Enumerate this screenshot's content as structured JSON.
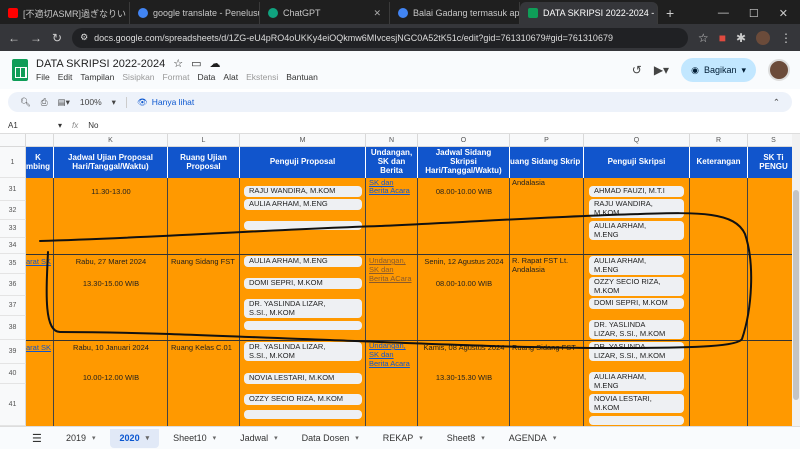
{
  "browser": {
    "tabs": [
      {
        "label": "[不適切ASMR]過ぎなりい",
        "color": "#ff0000"
      },
      {
        "label": "google translate - Penelusuran",
        "color": "#4285f4"
      },
      {
        "label": "ChatGPT",
        "color": "#10a37f"
      },
      {
        "label": "Balai Gadang termasuk apa",
        "color": "#4285f4"
      },
      {
        "label": "DATA SKRIPSI 2022-2024 - G",
        "color": "#0f9d58"
      }
    ],
    "url": "docs.google.com/spreadsheets/d/1ZG-eU4pRO4oUKKy4eiOQkmw6MIvcesjNGC0A52tK51c/edit?gid=761310679#gid=761310679"
  },
  "app": {
    "title": "DATA SKRIPSI 2022-2024",
    "menus": [
      "File",
      "Edit",
      "Tampilan",
      "Sisipkan",
      "Format",
      "Data",
      "Alat",
      "Ekstensi",
      "Bantuan"
    ],
    "menus_dim": [
      false,
      false,
      false,
      true,
      true,
      false,
      false,
      true,
      false
    ],
    "share_label": "Bagikan",
    "zoom": "100%",
    "view_mode": "Hanya lihat",
    "cell_ref": "A1",
    "formula": "No"
  },
  "columns": [
    "K",
    "L",
    "M",
    "N",
    "O",
    "P",
    "Q",
    "R",
    "S"
  ],
  "headers": {
    "j": "K\nmbing",
    "k": "Jadwal Ujian Proposal\nHari/Tanggal/Waktu)",
    "l": "Ruang Ujian\nProposal",
    "m": "Penguji Proposal",
    "n": "Undangan,\nSK dan\nBerita",
    "o": "Jadwal Sidang\nSkripsi\nHari/Tanggal/Waktu)",
    "p": "uang Sidang Skrip",
    "q": "Penguji Skripsi",
    "r": "Keterangan",
    "s": "SK Ti\nPENGU"
  },
  "rows": [
    "1",
    "31",
    "32",
    "33",
    "34",
    "35",
    "36",
    "37",
    "38",
    "39",
    "40",
    "41"
  ],
  "block1": {
    "time": "11.30-13.00",
    "examiners": [
      "RAJU WANDIRA, M.KOM",
      "AULIA ARHAM, M.ENG"
    ],
    "link": "Berita Acara",
    "link_top": "SK dan",
    "sidang_time": "08.00-10.00 WIB",
    "room_top": "Andalasia",
    "sidang_examiners": [
      "AHMAD FAUZI, M.T.I",
      "RAJU WANDIRA,\nM.KOM",
      "AULIA ARHAM,\nM.ENG"
    ]
  },
  "block2": {
    "sk_link": "arat SK",
    "date": "Rabu, 27 Maret 2024",
    "time": "13.30-15.00 WIB",
    "room": "Ruang Sidang FST",
    "examiners": [
      "AULIA ARHAM, M.ENG",
      "DOMI SEPRI, M.KOM",
      "DR. YASLINDA LIZAR,\nS.SI., M.KOM"
    ],
    "links": "Undangan,\nSK dan\nBerita ACara",
    "sidang_date": "Senin, 12 Agustus 2024",
    "sidang_time": "08.00-10.00 WIB",
    "sidang_room": "R. Rapat FST Lt.\nAndalasia",
    "sidang_examiners": [
      "AULIA ARHAM,\nM.ENG",
      "OZZY SECIO RIZA,\nM.KOM",
      "DOMI SEPRI, M.KOM",
      "DR. YASLINDA\nLIZAR, S.SI., M.KOM"
    ]
  },
  "block3": {
    "sk_link": "arat SK",
    "date": "Rabu, 10 Januari 2024",
    "time": "10.00-12.00 WIB",
    "room": "Ruang Kelas C.01",
    "examiners": [
      "DR. YASLINDA LIZAR,\nS.SI., M.KOM",
      "NOVIA LESTARI, M.KOM",
      "OZZY SECIO RIZA, M.KOM"
    ],
    "links": "Undangan,\nSK dan\nBerita Acara",
    "sidang_date": "Kamis, 08 Agustus 2024",
    "sidang_time": "13.30-15.30 WIB",
    "sidang_room": "Ruang Sidang FST",
    "sidang_examiners": [
      "DR. YASLINDA\nLIZAR, S.SI., M.KOM",
      "AULIA ARHAM,\nM.ENG",
      "NOVIA LESTARI,\nM.KOM"
    ]
  },
  "sheet_tabs": [
    "2019",
    "2020",
    "Sheet10",
    "Jadwal",
    "Data Dosen",
    "REKAP",
    "Sheet8",
    "AGENDA"
  ],
  "active_sheet": "2020"
}
